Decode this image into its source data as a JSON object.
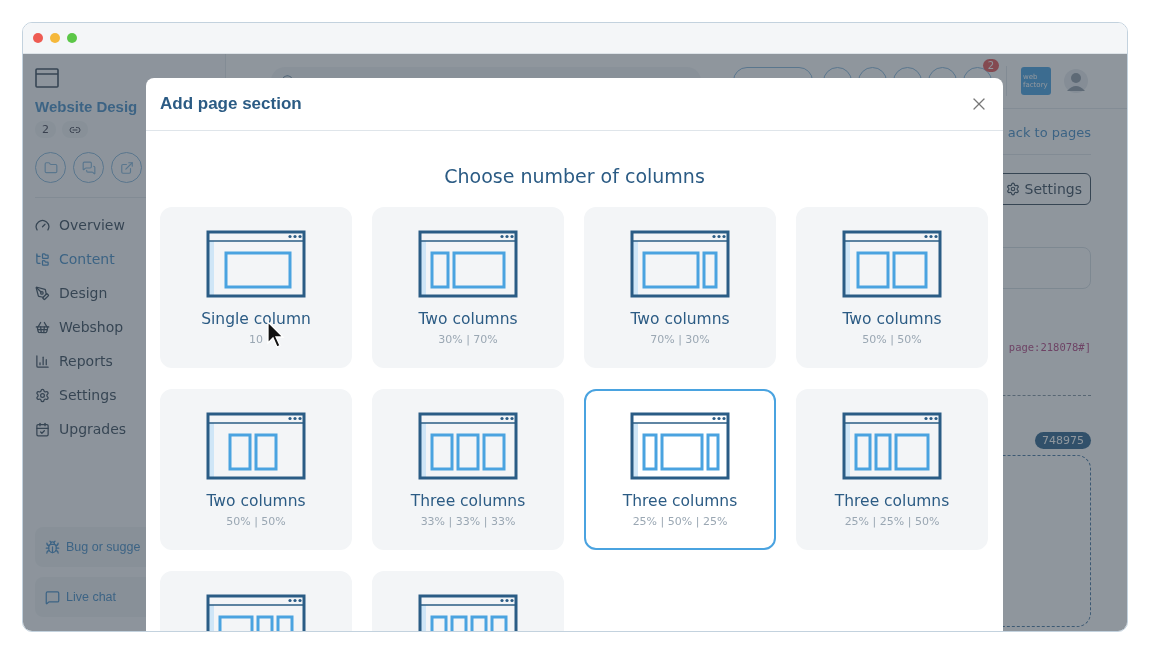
{
  "sidebar": {
    "project_title": "Website Desig",
    "chips": [
      "2"
    ],
    "nav": [
      {
        "label": "Overview",
        "selected": false
      },
      {
        "label": "Content",
        "selected": true
      },
      {
        "label": "Design",
        "selected": false
      },
      {
        "label": "Webshop",
        "selected": false
      },
      {
        "label": "Reports",
        "selected": false
      },
      {
        "label": "Settings",
        "selected": false
      },
      {
        "label": "Upgrades",
        "selected": false
      }
    ],
    "footer": [
      {
        "label": "Bug or sugge"
      },
      {
        "label": "Live chat"
      }
    ]
  },
  "topbar": {
    "notification_count": "2",
    "logo": "web factory"
  },
  "main": {
    "back_link": "ack to pages",
    "settings_button": "Settings",
    "code": "page:218078#]",
    "block_id": "748975"
  },
  "modal": {
    "title": "Add page section",
    "heading": "Choose number of columns",
    "cards": [
      {
        "kind": "single",
        "title": "Single column",
        "ratio": "10",
        "selected": false
      },
      {
        "kind": "two-30-70",
        "title": "Two columns",
        "ratio": "30% | 70%",
        "selected": false
      },
      {
        "kind": "two-70-30",
        "title": "Two columns",
        "ratio": "70% | 30%",
        "selected": false
      },
      {
        "kind": "two-50-50-wide",
        "title": "Two columns",
        "ratio": "50% | 50%",
        "selected": false
      },
      {
        "kind": "two-50-50-narrow",
        "title": "Two columns",
        "ratio": "50% | 50%",
        "selected": false
      },
      {
        "kind": "three-equal",
        "title": "Three columns",
        "ratio": "33% | 33% | 33%",
        "selected": false
      },
      {
        "kind": "three-25-50-25",
        "title": "Three columns",
        "ratio": "25% | 50% | 25%",
        "selected": true
      },
      {
        "kind": "three-25-25-50",
        "title": "Three columns",
        "ratio": "25% | 25% | 50%",
        "selected": false
      },
      {
        "kind": "three-50-25-25",
        "selected": false
      },
      {
        "kind": "four-equal",
        "selected": false
      }
    ]
  }
}
